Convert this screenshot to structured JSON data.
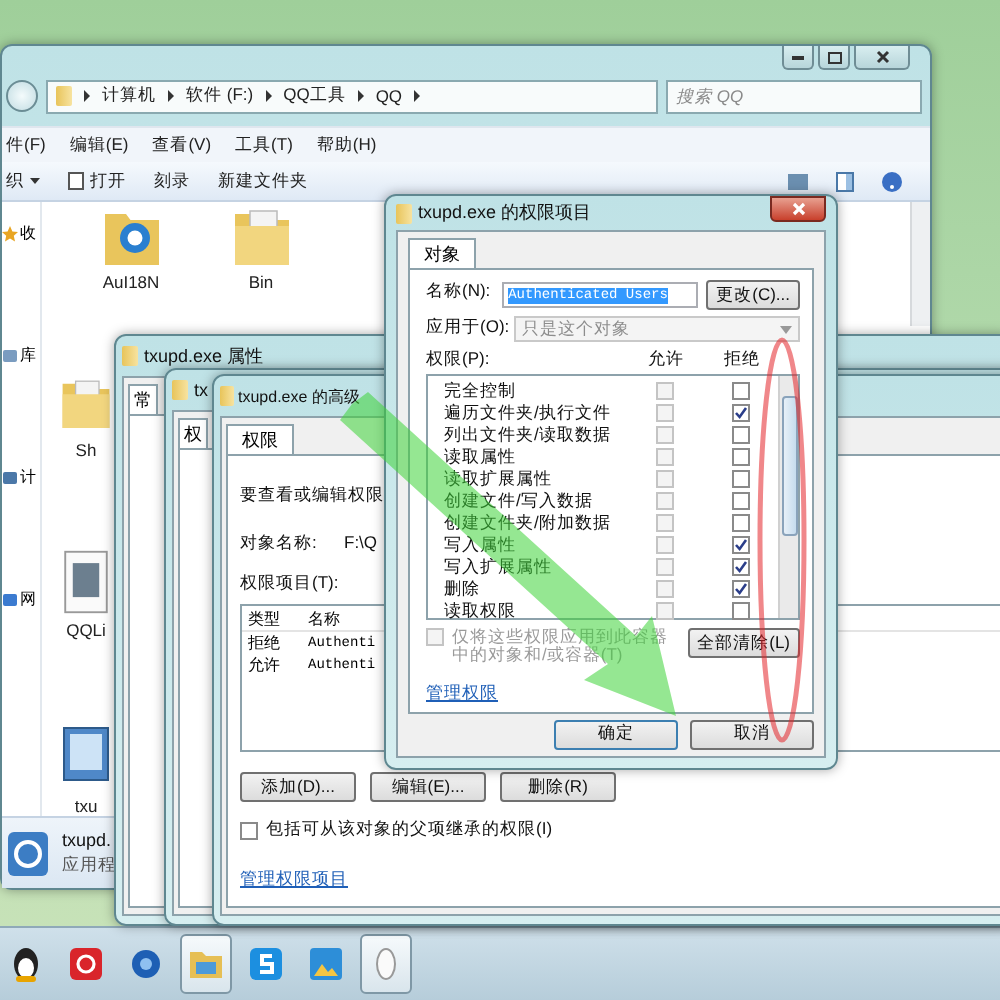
{
  "explorer": {
    "breadcrumbs": [
      "计算机",
      "软件 (F:)",
      "QQ工具",
      "QQ"
    ],
    "search": {
      "placeholder": "搜索 QQ"
    },
    "menu": [
      "件(F)",
      "编辑(E)",
      "查看(V)",
      "工具(T)",
      "帮助(H)"
    ],
    "toolbar": [
      "织",
      "打开",
      "刻录",
      "新建文件夹"
    ],
    "nav": [
      {
        "label": "收",
        "kind": "star"
      },
      {
        "label": "库",
        "kind": "library"
      },
      {
        "label": "计",
        "kind": "computer"
      },
      {
        "label": "网",
        "kind": "network"
      }
    ],
    "files_top": [
      {
        "label": "AuI18N",
        "kind": "ie"
      },
      {
        "label": "Bin",
        "kind": "folder"
      }
    ],
    "files_left": [
      {
        "label": "Sh",
        "kind": "folder"
      },
      {
        "label": "QQLi",
        "kind": "file"
      },
      {
        "label": "txu",
        "kind": "app"
      }
    ],
    "details": {
      "name": "txupd.",
      "type": "应用程"
    }
  },
  "back_windows": [
    {
      "title": "txupd.exe 属性",
      "tab": "常"
    },
    {
      "title": "tx",
      "tab": "权"
    }
  ],
  "advanced": {
    "title": "txupd.exe 的高级",
    "tab": "权限",
    "intro": "要查看或编辑权限",
    "object_label": "对象名称:",
    "object_value": "F:\\Q",
    "entries_label": "权限项目(T):",
    "columns": [
      "类型",
      "名称"
    ],
    "rows": [
      {
        "type": "拒绝",
        "name": "Authenti"
      },
      {
        "type": "允许",
        "name": "Authenti"
      }
    ],
    "buttons": [
      "添加(D)...",
      "编辑(E)...",
      "删除(R)"
    ],
    "inherit": {
      "label": "包括可从该对象的父项继承的权限(I)",
      "checked": false
    },
    "link": "管理权限项目"
  },
  "dialog": {
    "title": "txupd.exe 的权限项目",
    "tab": "对象",
    "name_label": "名称(N):",
    "name_value": "Authenticated Users",
    "name_selected": true,
    "change_button": "更改(C)...",
    "apply_label": "应用于(O):",
    "apply_value": "只是这个对象",
    "apply_disabled": true,
    "perm_label": "权限(P):",
    "allow_header": "允许",
    "deny_header": "拒绝",
    "permissions": [
      {
        "label": "完全控制",
        "allow": false,
        "deny": false
      },
      {
        "label": "遍历文件夹/执行文件",
        "allow": false,
        "deny": true
      },
      {
        "label": "列出文件夹/读取数据",
        "allow": false,
        "deny": false
      },
      {
        "label": "读取属性",
        "allow": false,
        "deny": false
      },
      {
        "label": "读取扩展属性",
        "allow": false,
        "deny": false
      },
      {
        "label": "创建文件/写入数据",
        "allow": false,
        "deny": false
      },
      {
        "label": "创建文件夹/附加数据",
        "allow": false,
        "deny": false
      },
      {
        "label": "写入属性",
        "allow": false,
        "deny": true
      },
      {
        "label": "写入扩展属性",
        "allow": false,
        "deny": true
      },
      {
        "label": "删除",
        "allow": false,
        "deny": true
      },
      {
        "label": "读取权限",
        "allow": false,
        "deny": false
      }
    ],
    "container_only": {
      "label": "仅将这些权限应用到此容器中的对象和/或容器(T)",
      "checked": false,
      "disabled": true
    },
    "clear_button": "全部清除(L)",
    "link": "管理权限",
    "ok": "确定",
    "cancel": "取消"
  },
  "taskbar": [
    {
      "kind": "qq",
      "active": false
    },
    {
      "kind": "red",
      "active": false
    },
    {
      "kind": "blue",
      "active": false
    },
    {
      "kind": "explorer",
      "active": true
    },
    {
      "kind": "s",
      "active": false
    },
    {
      "kind": "photo",
      "active": false
    },
    {
      "kind": "mouse",
      "active": true
    }
  ]
}
